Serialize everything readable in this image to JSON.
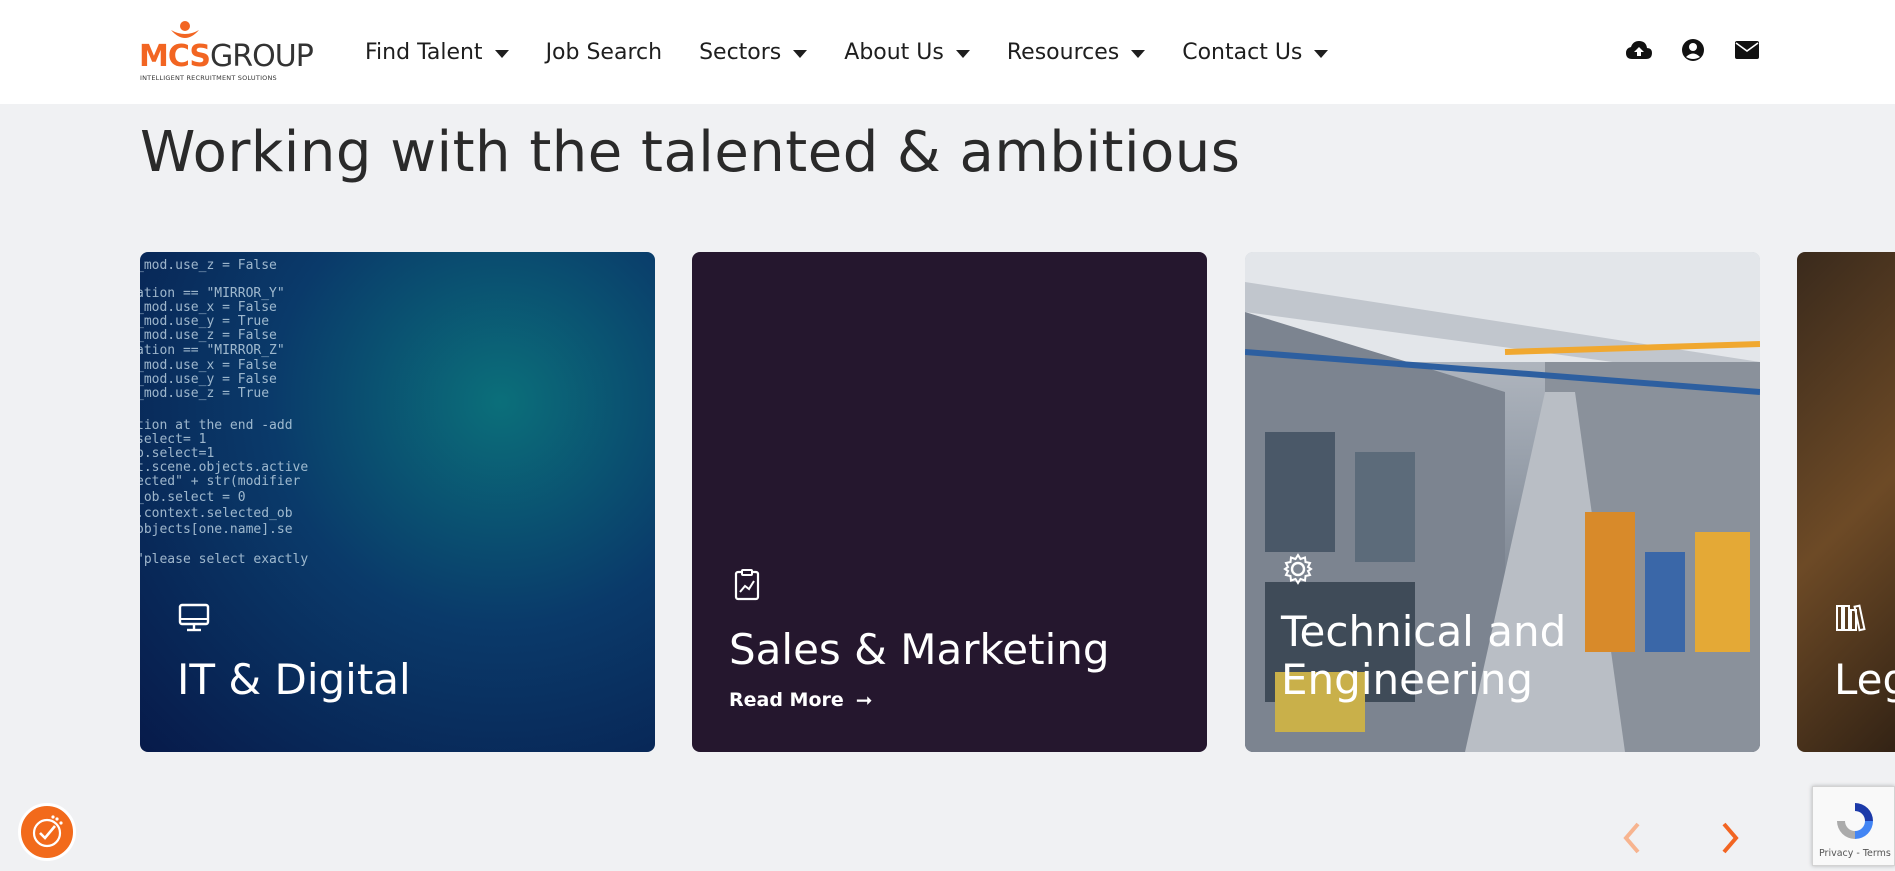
{
  "header": {
    "logo": {
      "brand_primary": "MCS",
      "brand_secondary": "GROUP",
      "tagline": "INTELLIGENT RECRUITMENT SOLUTIONS"
    },
    "nav": [
      {
        "label": "Find Talent",
        "has_dropdown": true
      },
      {
        "label": "Job Search",
        "has_dropdown": false
      },
      {
        "label": "Sectors",
        "has_dropdown": true
      },
      {
        "label": "About Us",
        "has_dropdown": true
      },
      {
        "label": "Resources",
        "has_dropdown": true
      },
      {
        "label": "Contact Us",
        "has_dropdown": true
      }
    ],
    "icons": [
      "cloud-upload-icon",
      "user-circle-icon",
      "envelope-icon"
    ]
  },
  "main": {
    "headline": "Working with the talented & ambitious",
    "cards": [
      {
        "title": "IT & Digital",
        "icon": "monitor-icon"
      },
      {
        "title": "Sales & Marketing",
        "icon": "chart-clipboard-icon",
        "link": "Read More"
      },
      {
        "title_line1": "Technical and",
        "title_line2": "Engineering",
        "icon": "gear-icon"
      },
      {
        "title": "Leg",
        "icon": "library-books-icon"
      }
    ],
    "code_lines": [
      "_mod.use_z = False",
      "ation == \"MIRROR_Y\"",
      "_mod.use_x = False",
      "_mod.use_y = True",
      "_mod.use_z = False",
      "ation == \"MIRROR_Z\"",
      "_mod.use_x = False",
      "_mod.use_y = False",
      "_mod.use_z = True",
      "tion at the end -add",
      "select= 1",
      "b.select=1",
      "t.scene.objects.active",
      "ected\" + str(modifier",
      "_ob.select = 0",
      ".context.selected_ob",
      "objects[one.name].se",
      "\"please select exactly"
    ]
  },
  "footer": {
    "recaptcha_links": "Privacy - Terms"
  },
  "colors": {
    "accent": "#f26522",
    "sales_card_bg": "#25172e",
    "header_bg": "#ffffff",
    "page_bg": "#f0f1f3"
  }
}
